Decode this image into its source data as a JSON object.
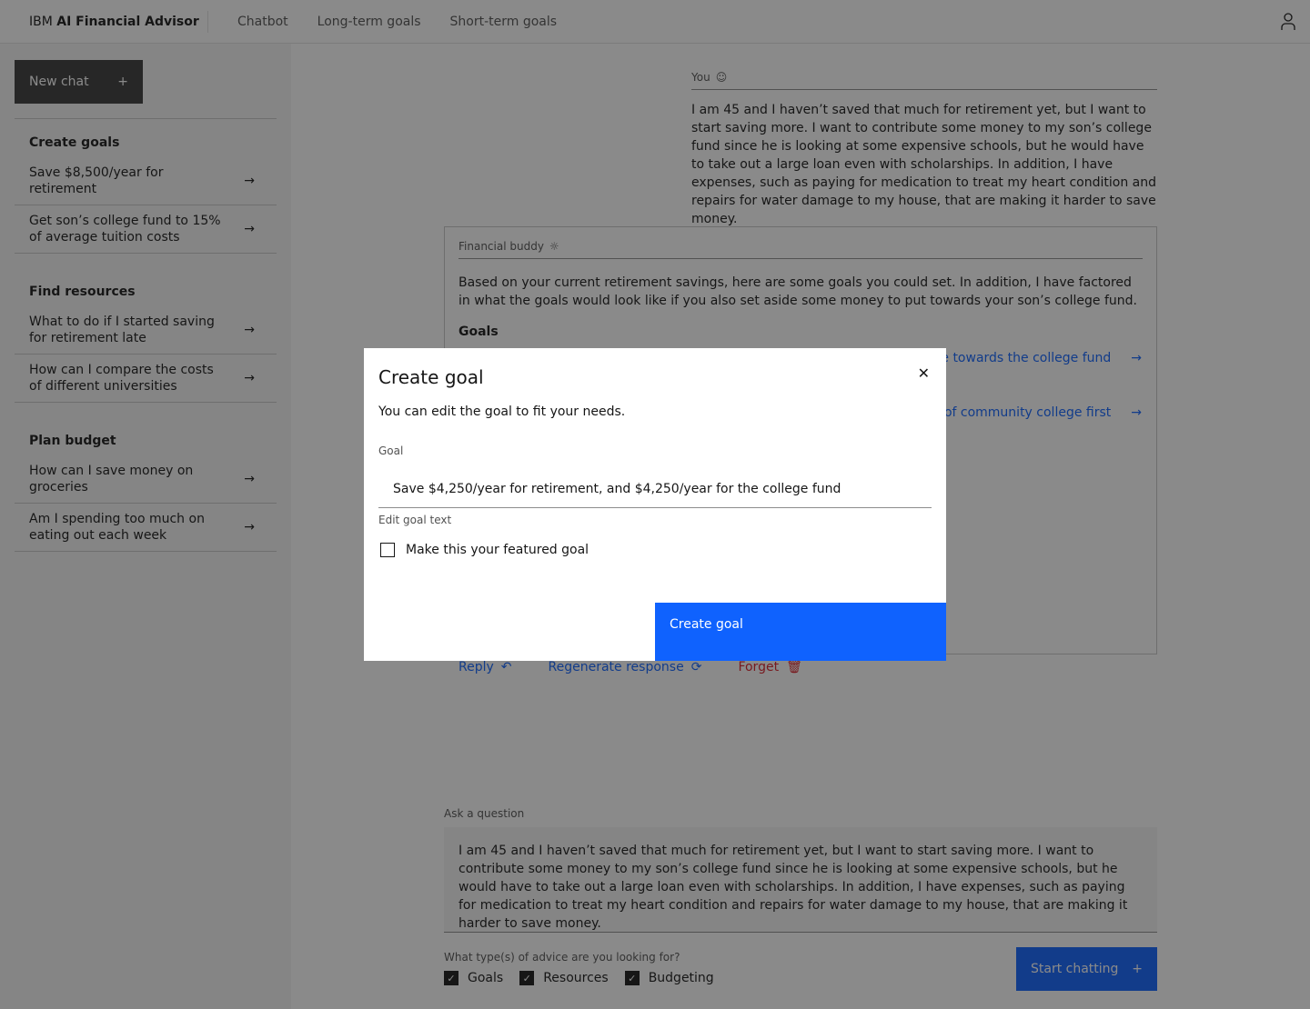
{
  "header": {
    "brand_prefix": "IBM",
    "brand_name": "AI Financial Advisor",
    "nav": [
      "Chatbot",
      "Long-term goals",
      "Short-term goals"
    ]
  },
  "sidebar": {
    "new_chat": "New chat",
    "sections": [
      {
        "title": "Create goals",
        "items": [
          "Save $8,500/year for retirement",
          "Get son’s college fund to 15% of average tuition costs"
        ]
      },
      {
        "title": "Find resources",
        "items": [
          "What to do if I started saving for retirement late",
          "How can I compare the costs of different universities"
        ]
      },
      {
        "title": "Plan budget",
        "items": [
          "How can I save money on groceries",
          "Am I spending too much on eating out each week"
        ]
      }
    ]
  },
  "chat": {
    "you_label": "You",
    "you_message": "I am 45 and I haven’t saved that much for retirement yet, but I want to start saving more. I want to contribute some money to my son’s college fund since he is looking at some expensive schools, but he would have to take out a large loan even with scholarships. In addition, I have expenses, such as paying for medication to treat my heart condition and repairs for water damage to my house, that are making it harder to save money.",
    "buddy_label": "Financial buddy",
    "buddy_message": "Based on your current retirement savings, here are some goals you could set. In addition, I have factored in what the goals would look like if you also set aside some money to put towards your son’s college fund.",
    "goals_heading": "Goals",
    "goal_links": [
      "ve towards the college fund",
      "ars of community college first"
    ],
    "actions": {
      "reply": "Reply",
      "regenerate": "Regenerate response",
      "forget": "Forget"
    }
  },
  "ask": {
    "label": "Ask a question",
    "value": "I am 45 and I haven’t saved that much for retirement yet, but I want to start saving more. I want to contribute some money to my son’s college fund since he is looking at some expensive schools, but he would have to take out a large loan even with scholarships. In addition, I have expenses, such as paying for medication to treat my heart condition and repairs for water damage to my house, that are making it harder to save money.",
    "advice_label": "What type(s) of advice are you looking for?",
    "advice": [
      {
        "label": "Goals",
        "checked": true
      },
      {
        "label": "Resources",
        "checked": true
      },
      {
        "label": "Budgeting",
        "checked": true
      }
    ],
    "start": "Start chatting"
  },
  "modal": {
    "title": "Create goal",
    "description": "You can edit the goal to fit your needs.",
    "goal_label": "Goal",
    "goal_value": "Save $4,250/year for retirement, and $4,250/year for the college fund",
    "helper": "Edit goal text",
    "featured": "Make this your featured goal",
    "featured_checked": false,
    "submit": "Create goal"
  },
  "colors": {
    "primary": "#0f62fe",
    "danger": "#da1e28",
    "dark": "#393939"
  }
}
